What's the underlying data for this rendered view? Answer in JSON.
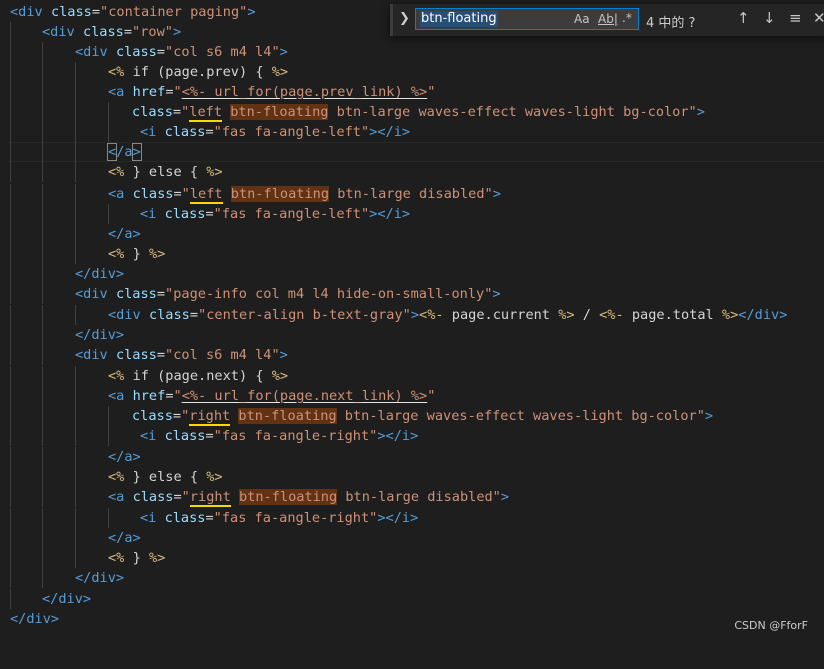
{
  "find_widget": {
    "toggle_icon": "chevron-right-icon",
    "query": "btn-floating",
    "match_case": "Aa",
    "whole_word": "Ab|",
    "regex": ".*",
    "result_count": "4 中的 ?",
    "prev_icon": "arrow-up-icon",
    "next_icon": "arrow-down-icon",
    "selection_icon": "find-in-selection-icon",
    "close_icon": "close-icon"
  },
  "watermark": "CSDN @FforF",
  "code_lines": [
    "<div class=\"container paging\">",
    "<div class=\"row\">",
    "<div class=\"col s6 m4 l4\">",
    "<% if (page.prev) { %>",
    "<a href=\"<%- url_for(page.prev_link) %>\"",
    "class=\"left btn-floating btn-large waves-effect waves-light bg-color\">",
    "<i class=\"fas fa-angle-left\"></i>",
    "</a>",
    "<% } else { %>",
    "<a class=\"left btn-floating btn-large disabled\">",
    "<i class=\"fas fa-angle-left\"></i>",
    "</a>",
    "<% } %>",
    "</div>",
    "<div class=\"page-info col m4 l4 hide-on-small-only\">",
    "<div class=\"center-align b-text-gray\"><%- page.current %> / <%- page.total %></div>",
    "</div>",
    "<div class=\"col s6 m4 l4\">",
    "<% if (page.next) { %>",
    "<a href=\"<%- url_for(page.next_link) %>\"",
    "class=\"right btn-floating btn-large waves-effect waves-light bg-color\">",
    "<i class=\"fas fa-angle-right\"></i>",
    "</a>",
    "<% } else { %>",
    "<a class=\"right btn-floating btn-large disabled\">",
    "<i class=\"fas fa-angle-right\"></i>",
    "</a>",
    "<% } %>",
    "</div>",
    "</div>",
    "</div>"
  ]
}
